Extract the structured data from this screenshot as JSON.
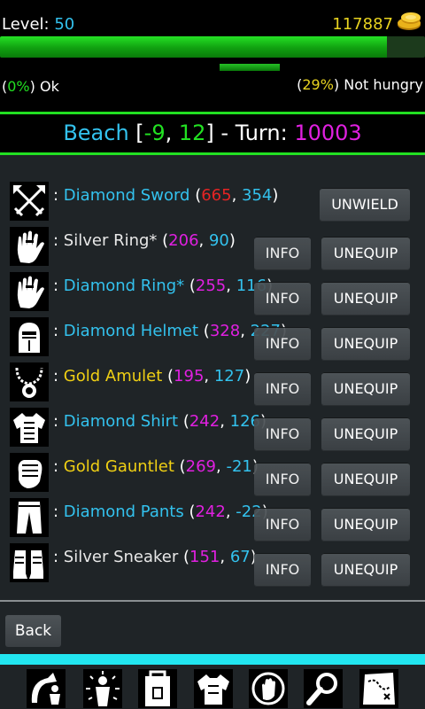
{
  "header": {
    "level_label": "Level: ",
    "level_value": "50",
    "gold": "117887",
    "hp_fraction": 0.91,
    "food_fraction": 0.29,
    "status_left": {
      "open": "(",
      "pct": "0%",
      "close": ") ",
      "word": "Ok"
    },
    "status_right": {
      "open": "(",
      "pct": "29%",
      "close": ") ",
      "word": "Not hungry"
    }
  },
  "location": {
    "name": "Beach",
    "open": " [",
    "x": "-9",
    "comma": ", ",
    "y": "12",
    "close": "] - Turn: ",
    "turn": "10003"
  },
  "equipment": [
    {
      "icon": "crossed-swords-icon",
      "name": "Diamond Sword",
      "color": "#33c2ee",
      "a": "665",
      "a_color": "#e52424",
      "b": "354",
      "b_color": "#33c2ee",
      "action": "UNWIELD",
      "has_info": false
    },
    {
      "icon": "hand-ring-icon",
      "name": "Silver Ring*",
      "color": "#e8e8e8",
      "a": "206",
      "a_color": "#e020e0",
      "b": "90",
      "b_color": "#33c2ee",
      "action": "UNEQUIP",
      "has_info": true
    },
    {
      "icon": "hand-ring-icon",
      "name": "Diamond Ring*",
      "color": "#33c2ee",
      "a": "255",
      "a_color": "#e020e0",
      "b": "116",
      "b_color": "#33c2ee",
      "action": "UNEQUIP",
      "has_info": true
    },
    {
      "icon": "helmet-icon",
      "name": "Diamond Helmet",
      "color": "#33c2ee",
      "a": "328",
      "a_color": "#e020e0",
      "b": "227",
      "b_color": "#33c2ee",
      "action": "UNEQUIP",
      "has_info": true
    },
    {
      "icon": "amulet-icon",
      "name": "Gold Amulet",
      "color": "#f0d014",
      "a": "195",
      "a_color": "#e020e0",
      "b": "127",
      "b_color": "#33c2ee",
      "action": "UNEQUIP",
      "has_info": true
    },
    {
      "icon": "shirt-armor-icon",
      "name": "Diamond Shirt",
      "color": "#33c2ee",
      "a": "242",
      "a_color": "#e020e0",
      "b": "126",
      "b_color": "#33c2ee",
      "action": "UNEQUIP",
      "has_info": true
    },
    {
      "icon": "gauntlet-icon",
      "name": "Gold Gauntlet",
      "color": "#f0d014",
      "a": "269",
      "a_color": "#e020e0",
      "b": "-21",
      "b_color": "#33c2ee",
      "action": "UNEQUIP",
      "has_info": true
    },
    {
      "icon": "pants-icon",
      "name": "Diamond Pants",
      "color": "#33c2ee",
      "a": "242",
      "a_color": "#e020e0",
      "b": "-22",
      "b_color": "#33c2ee",
      "action": "UNEQUIP",
      "has_info": true
    },
    {
      "icon": "sneaker-icon",
      "name": "Silver Sneaker",
      "color": "#e8e8e8",
      "a": "151",
      "a_color": "#e020e0",
      "b": "67",
      "b_color": "#33c2ee",
      "action": "UNEQUIP",
      "has_info": true
    }
  ],
  "info_label": "INFO",
  "back_label": "Back",
  "toolbar": [
    {
      "icon": "travel-icon"
    },
    {
      "icon": "character-aura-icon"
    },
    {
      "icon": "inventory-bag-icon"
    },
    {
      "icon": "equipment-armor-icon"
    },
    {
      "icon": "magic-hand-icon"
    },
    {
      "icon": "search-magnifier-icon"
    },
    {
      "icon": "map-icon"
    }
  ],
  "colors": {
    "accent_green": "#22e022",
    "cyan": "#33c2ee",
    "magenta": "#e020e0",
    "gold": "#e8d320",
    "toolbar_strip": "#22e6f0"
  }
}
